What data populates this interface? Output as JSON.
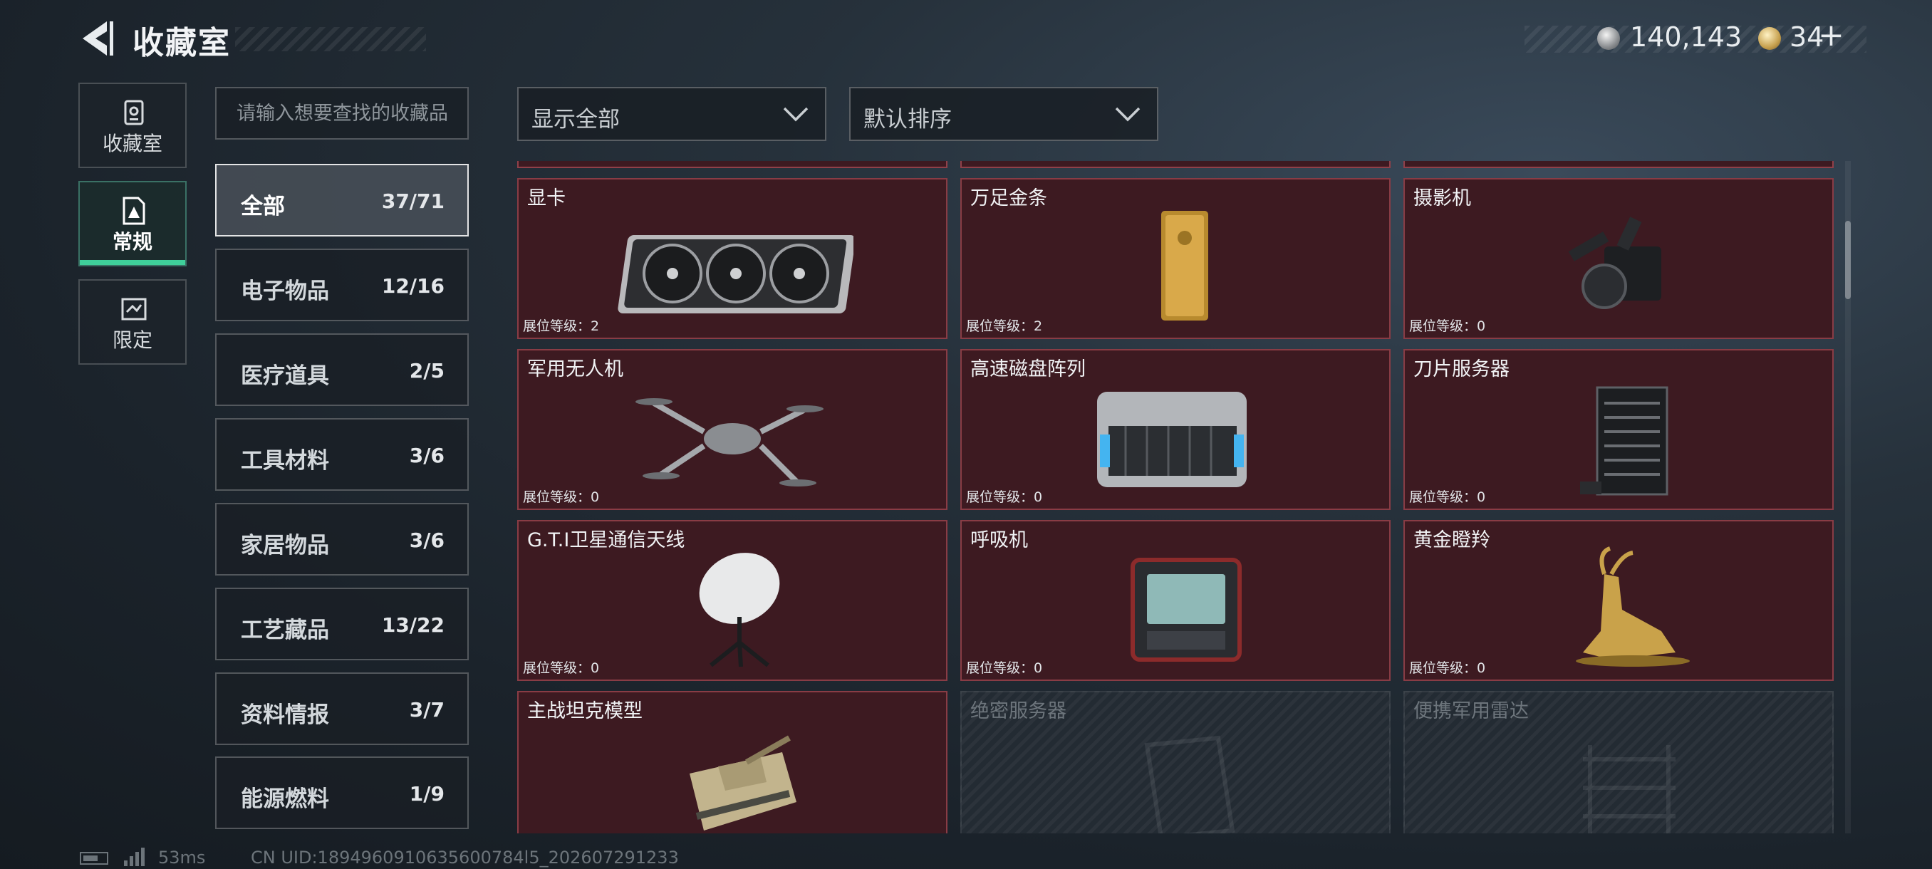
{
  "header": {
    "title": "收藏室",
    "silver_amount": "140,143",
    "gold_amount": "34",
    "plus": "+"
  },
  "nav": {
    "tabs": [
      {
        "label": "收藏室",
        "icon": "collection-room-icon"
      },
      {
        "label": "常规",
        "icon": "regular-icon",
        "active": true
      },
      {
        "label": "限定",
        "icon": "limited-icon"
      }
    ]
  },
  "search": {
    "placeholder": "请输入想要查找的收藏品"
  },
  "filters": {
    "show": "显示全部",
    "sort": "默认排序"
  },
  "categories": [
    {
      "name": "全部",
      "count": "37/71",
      "active": true
    },
    {
      "name": "电子物品",
      "count": "12/16"
    },
    {
      "name": "医疗道具",
      "count": "2/5"
    },
    {
      "name": "工具材料",
      "count": "3/6"
    },
    {
      "name": "家居物品",
      "count": "3/6"
    },
    {
      "name": "工艺藏品",
      "count": "13/22"
    },
    {
      "name": "资料情报",
      "count": "3/7"
    },
    {
      "name": "能源燃料",
      "count": "1/9"
    }
  ],
  "items": [
    {
      "name": "显卡",
      "level": "展位等级：2",
      "icon": "graphics-card-icon"
    },
    {
      "name": "万足金条",
      "level": "展位等级：2",
      "icon": "gold-bar-icon"
    },
    {
      "name": "摄影机",
      "level": "展位等级：0",
      "icon": "camera-icon"
    },
    {
      "name": "军用无人机",
      "level": "展位等级：0",
      "icon": "drone-icon"
    },
    {
      "name": "高速磁盘阵列",
      "level": "展位等级：0",
      "icon": "disk-array-icon"
    },
    {
      "name": "刀片服务器",
      "level": "展位等级：0",
      "icon": "blade-server-icon"
    },
    {
      "name": "G.T.I卫星通信天线",
      "level": "展位等级：0",
      "icon": "satellite-antenna-icon"
    },
    {
      "name": "呼吸机",
      "level": "展位等级：0",
      "icon": "ventilator-icon"
    },
    {
      "name": "黄金瞪羚",
      "level": "展位等级：0",
      "icon": "golden-gazelle-icon"
    },
    {
      "name": "主战坦克模型",
      "level": "",
      "icon": "tank-model-icon"
    },
    {
      "name": "绝密服务器",
      "level": "",
      "icon": "server-icon",
      "locked": true
    },
    {
      "name": "便携军用雷达",
      "level": "",
      "icon": "radar-icon",
      "locked": true
    }
  ],
  "status": {
    "ping": "53ms",
    "uid": "CN UID:1894960910635600784l5_202607291233"
  },
  "colors": {
    "owned_card": "#3d1a21",
    "active_tab_accent": "#3fcf9a"
  }
}
